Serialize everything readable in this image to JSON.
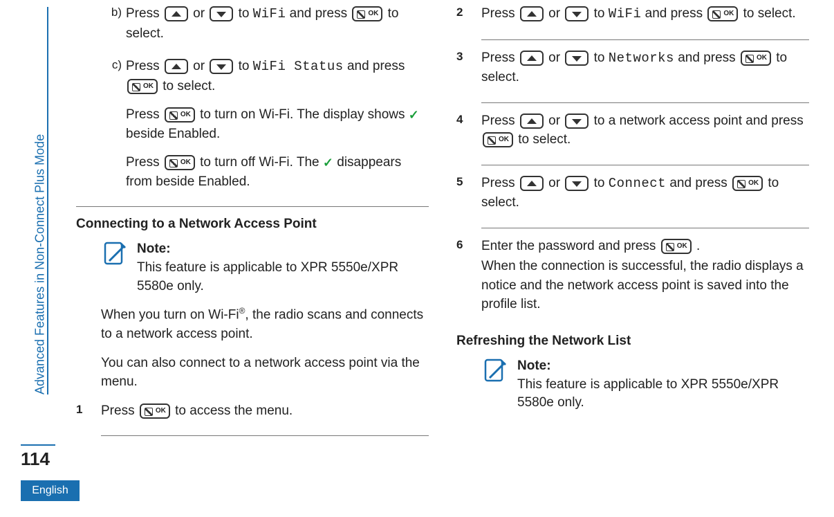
{
  "sidebar": {
    "title": "Advanced Features in Non-Connect Plus Mode"
  },
  "page_number": "114",
  "language_tab": "English",
  "left": {
    "step_b": {
      "label": "b)",
      "text_parts": [
        "Press ",
        " or ",
        " to ",
        " and press ",
        " to select."
      ],
      "menu": "WiFi"
    },
    "step_c": {
      "label": "c)",
      "p1_parts": [
        "Press ",
        " or ",
        " to ",
        " and press ",
        " to select."
      ],
      "p1_menu": "WiFi Status",
      "p2_parts": [
        "Press ",
        " to turn on Wi-Fi. The display shows ",
        " beside Enabled."
      ],
      "p3_parts": [
        "Press ",
        " to turn off Wi-Fi. The ",
        " disappears from beside Enabled."
      ]
    },
    "heading1": "Connecting to a Network Access Point",
    "note1": {
      "title": "Note:",
      "body": "This feature is applicable to XPR 5550e/XPR 5580e only."
    },
    "para1_a": "When you turn on Wi-Fi",
    "para1_b": ", the radio scans and connects to a network access point.",
    "para2": "You can also connect to a network access point via the menu.",
    "step1": {
      "label": "1",
      "text_parts": [
        "Press ",
        " to access the menu."
      ]
    }
  },
  "right": {
    "step2": {
      "label": "2",
      "text_parts": [
        "Press ",
        " or ",
        " to ",
        " and press ",
        " to select."
      ],
      "menu": "WiFi"
    },
    "step3": {
      "label": "3",
      "text_parts": [
        "Press ",
        " or ",
        " to ",
        " and press ",
        " to select."
      ],
      "menu": "Networks"
    },
    "step4": {
      "label": "4",
      "text_parts": [
        "Press ",
        " or ",
        " to a network access point and press ",
        " to select."
      ]
    },
    "step5": {
      "label": "5",
      "text_parts": [
        "Press ",
        " or ",
        " to ",
        " and press ",
        " to select."
      ],
      "menu": "Connect"
    },
    "step6": {
      "label": "6",
      "line1_parts": [
        "Enter the password and press ",
        " ."
      ],
      "line2": "When the connection is successful, the radio displays a notice and the network access point is saved into the profile list."
    },
    "heading2": "Refreshing the Network List",
    "note2": {
      "title": "Note:",
      "body": "This feature is applicable to XPR 5550e/XPR 5580e only."
    }
  }
}
